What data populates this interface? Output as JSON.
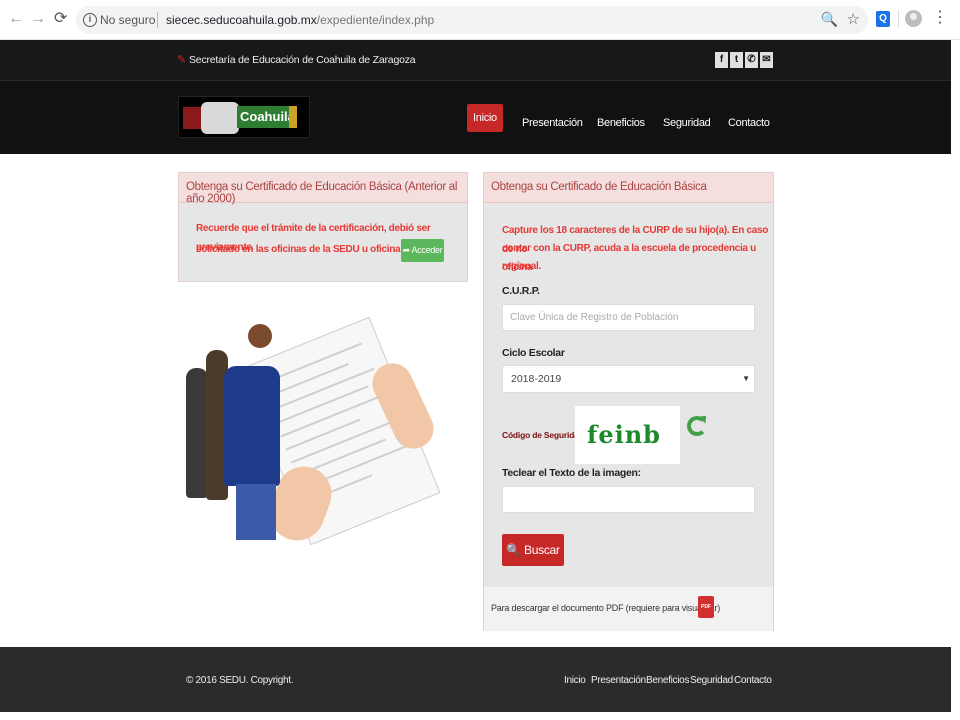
{
  "browser": {
    "security_label": "No seguro",
    "url_host": "siecec.seducoahuila.gob.mx",
    "url_path": "/expediente/index.php"
  },
  "topbar": {
    "org_name": "Secretaría de Educación de Coahuila de Zaragoza",
    "social": [
      "f",
      "t",
      "✆",
      "✉"
    ]
  },
  "header": {
    "logo_text": "Coahuila",
    "nav": [
      "Inicio",
      "Presentación",
      "Beneficios",
      "Seguridad",
      "Contacto"
    ],
    "active_nav": "Inicio"
  },
  "left_panel": {
    "title": "Obtenga su Certificado de Educación Básica (Anterior al año 2000)",
    "notice_line1": "Recuerde que el trámite de la certificación, debió ser previamente",
    "notice_line2": "solicitado en las oficinas de la SEDU u oficina regional.",
    "button_label": "➦ Acceder"
  },
  "right_panel": {
    "title": "Obtenga su Certificado de Educación Básica",
    "notice_line1": "Capture los 18 caracteres de la CURP de su hijo(a). En caso de no",
    "notice_line2": "contar con la CURP, acuda a la escuela de procedencia u oficina",
    "notice_line3": "regional.",
    "curp_label": "C.U.R.P.",
    "curp_placeholder": "Clave Única de Registro de Población",
    "ciclo_label": "Ciclo Escolar",
    "ciclo_value": "2018-2019",
    "codigo_label": "Código de Seguridad:",
    "captcha_text": "feinb",
    "teclear_label": "Teclear el Texto de la imagen:",
    "buscar_label": "🔍 Buscar",
    "pdf_text": "Para descargar el documento PDF (requiere para visualizar)",
    "pdf_icon_text": "PDF"
  },
  "footer": {
    "copyright": "© 2016 SEDU. Copyright.",
    "links": [
      "Inicio",
      "Presentación",
      "Beneficios",
      "Seguridad",
      "Contacto"
    ]
  },
  "colors": {
    "accent_red": "#c62828",
    "success_green": "#5cb85c",
    "panel_header_bg": "#f4dede"
  }
}
